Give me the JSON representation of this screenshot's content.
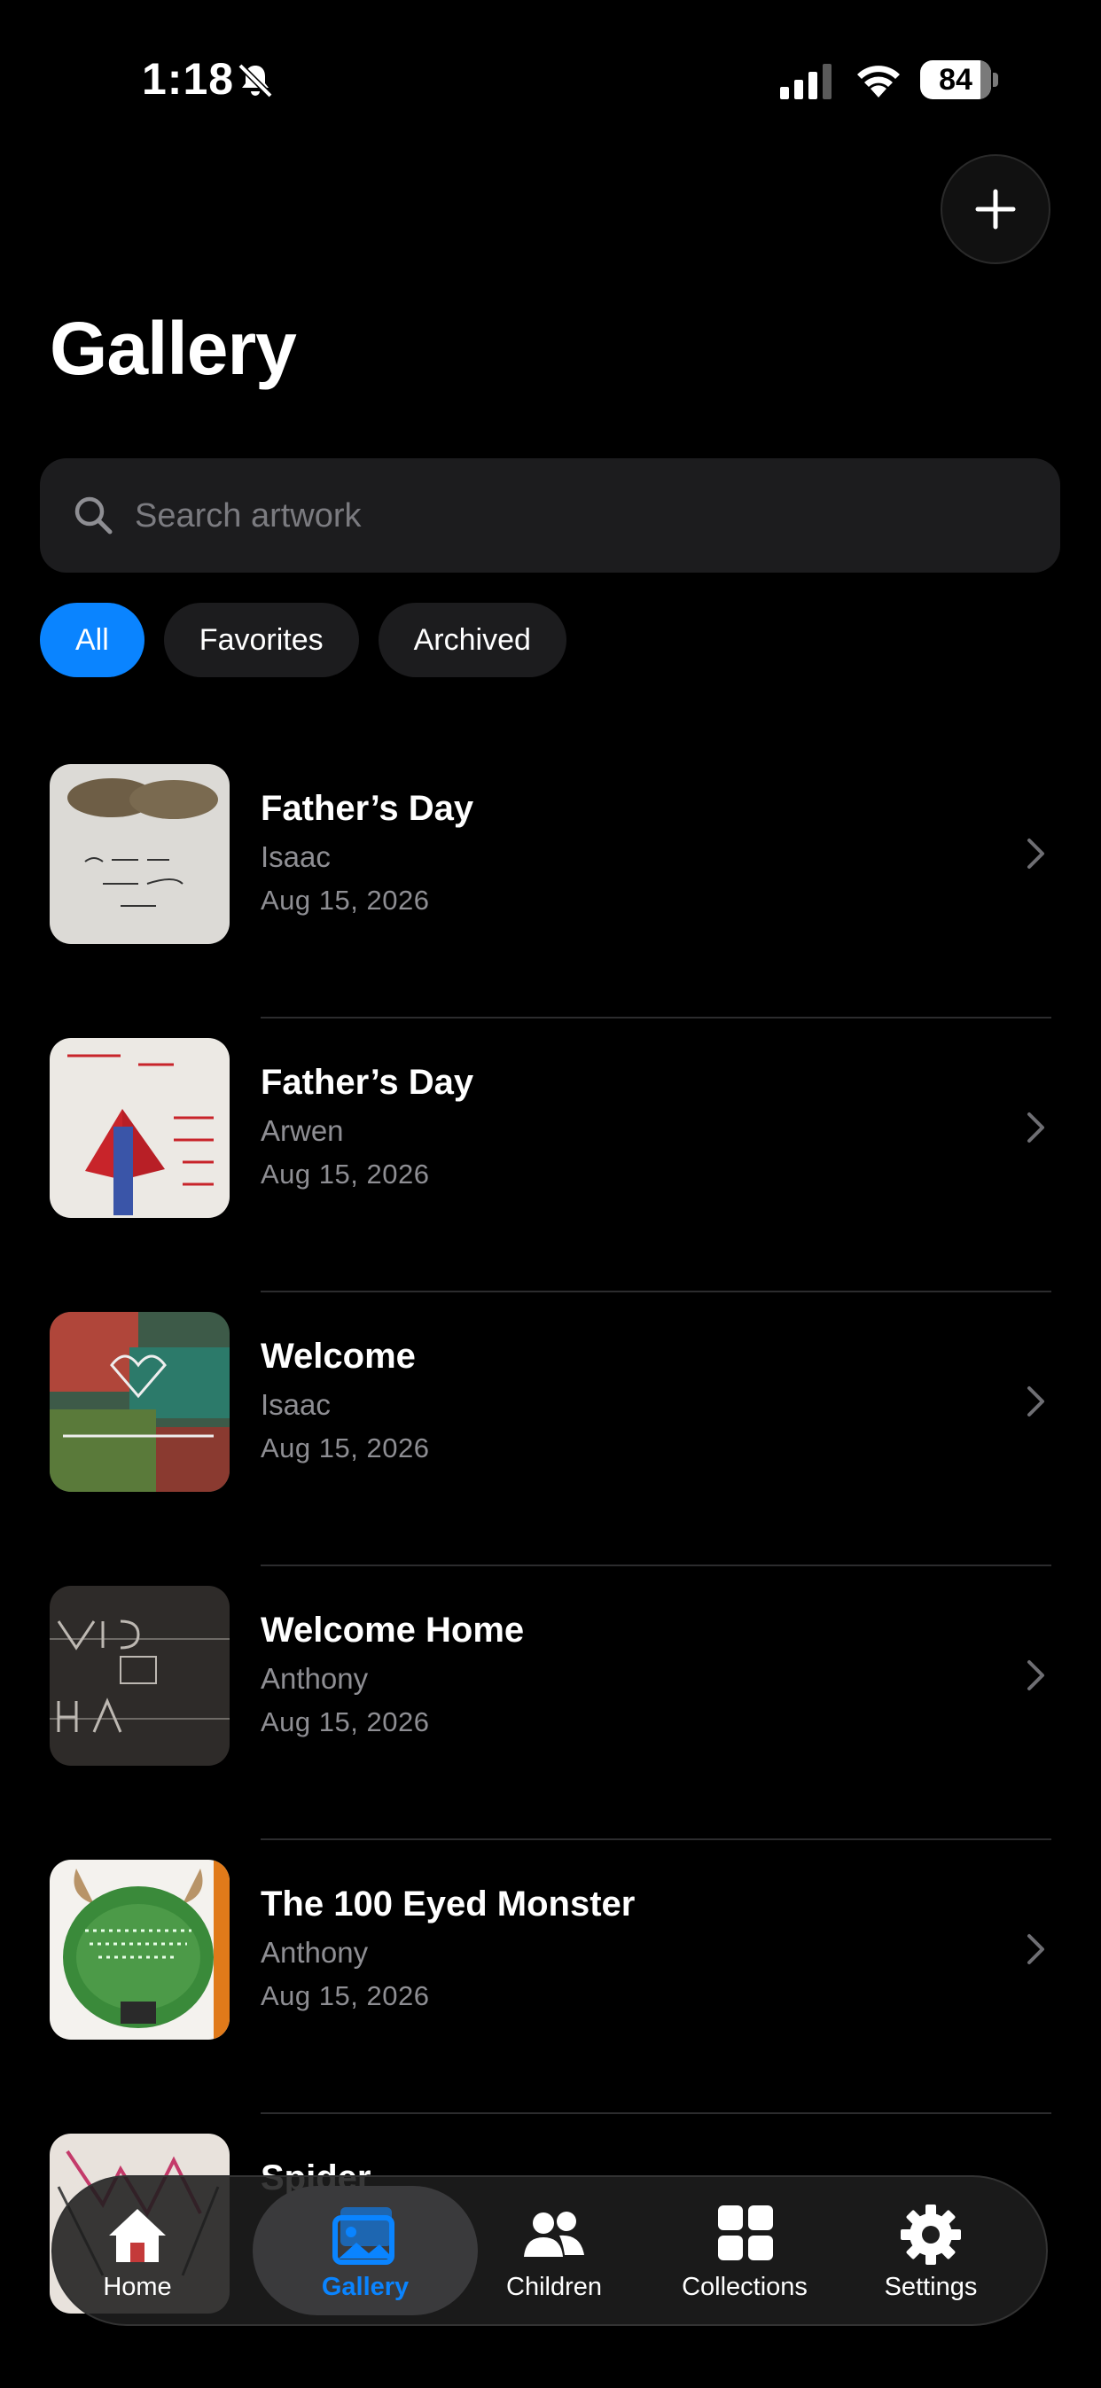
{
  "status_bar": {
    "time": "1:18",
    "battery": "84"
  },
  "header": {
    "title": "Gallery"
  },
  "search": {
    "placeholder": "Search artwork"
  },
  "filters": [
    {
      "label": "All",
      "active": true
    },
    {
      "label": "Favorites",
      "active": false
    },
    {
      "label": "Archived",
      "active": false
    }
  ],
  "artworks": [
    {
      "title": "Father’s Day",
      "child": "Isaac",
      "date": "Aug 15, 2026"
    },
    {
      "title": "Father’s Day",
      "child": "Arwen",
      "date": "Aug 15, 2026"
    },
    {
      "title": "Welcome",
      "child": "Isaac",
      "date": "Aug 15, 2026"
    },
    {
      "title": "Welcome Home",
      "child": "Anthony",
      "date": "Aug 15, 2026"
    },
    {
      "title": "The 100 Eyed Monster",
      "child": "Anthony",
      "date": "Aug 15, 2026"
    },
    {
      "title": "Spider",
      "child": "",
      "date": ""
    }
  ],
  "tabbar": {
    "items": [
      {
        "label": "Home",
        "icon": "house-icon"
      },
      {
        "label": "Gallery",
        "icon": "photos-icon",
        "active": true
      },
      {
        "label": "Children",
        "icon": "people-icon"
      },
      {
        "label": "Collections",
        "icon": "grid-icon"
      },
      {
        "label": "Settings",
        "icon": "gear-icon"
      }
    ]
  },
  "colors": {
    "accent": "#0a84ff",
    "background": "#000000",
    "surface": "#1c1c1e"
  }
}
